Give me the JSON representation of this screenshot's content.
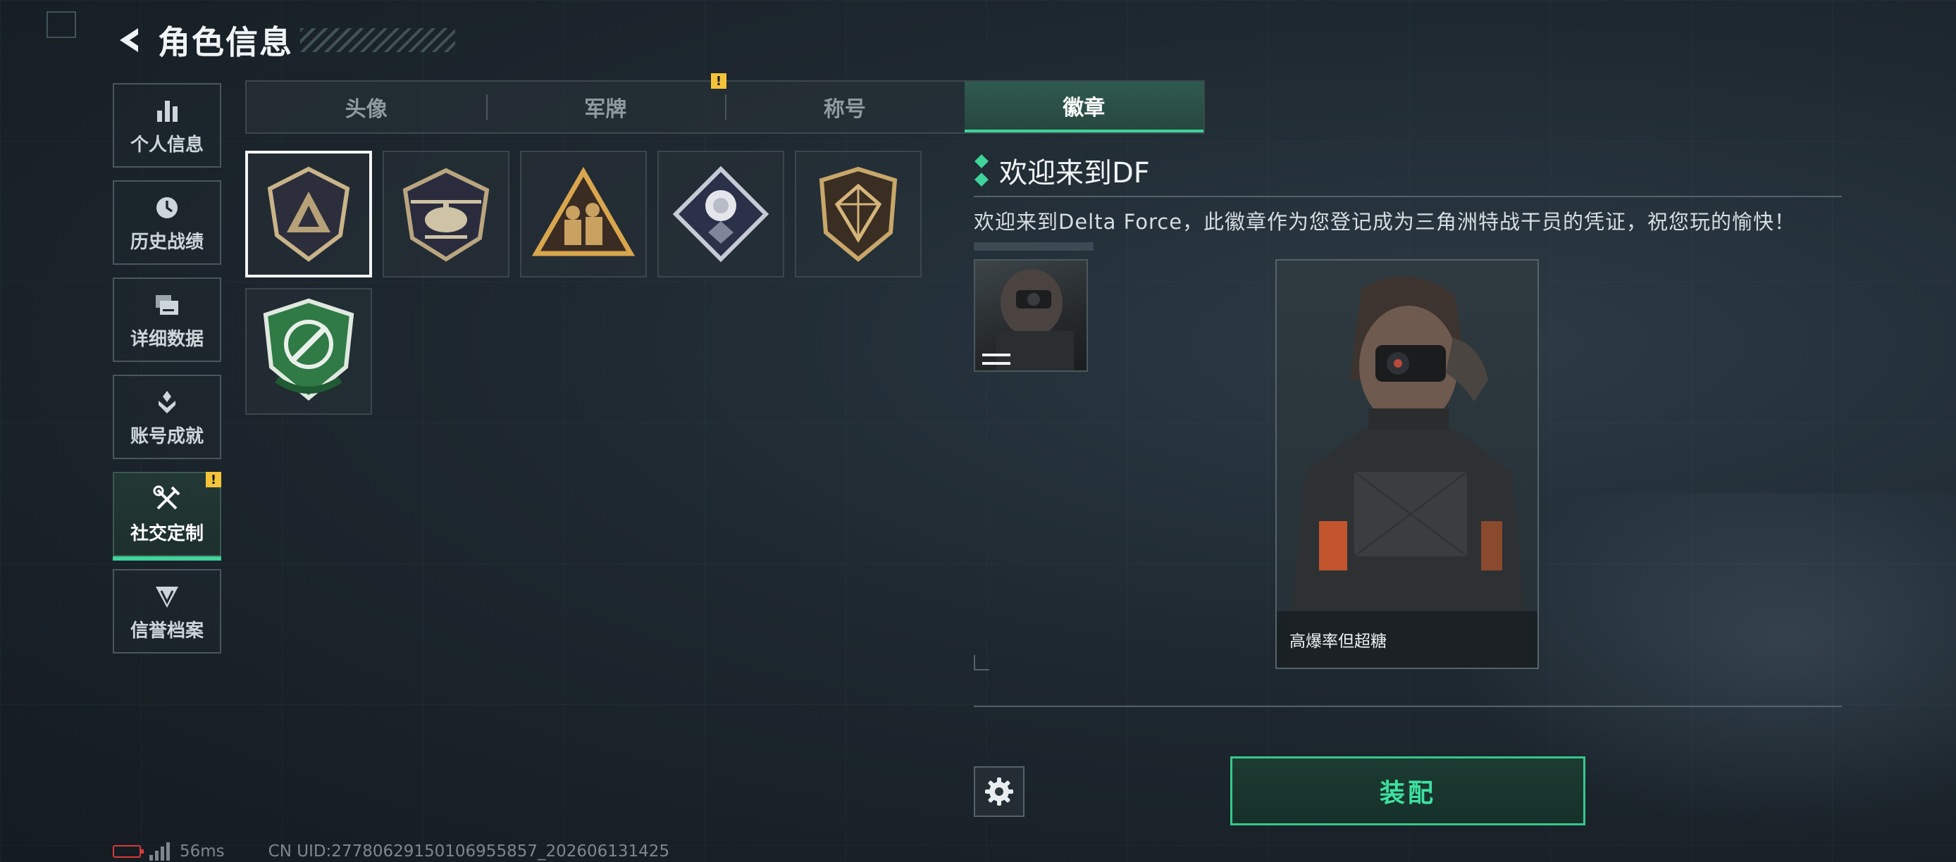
{
  "header": {
    "title": "角色信息"
  },
  "sidebar": {
    "items": [
      {
        "label": "个人信息",
        "icon": "bar-chart-icon",
        "active": false
      },
      {
        "label": "历史战绩",
        "icon": "history-icon",
        "active": false
      },
      {
        "label": "详细数据",
        "icon": "folder-icon",
        "active": false
      },
      {
        "label": "账号成就",
        "icon": "achievement-icon",
        "active": false
      },
      {
        "label": "社交定制",
        "icon": "tools-icon",
        "active": true,
        "alert": "!"
      },
      {
        "label": "信誉档案",
        "icon": "reputation-icon",
        "active": false
      }
    ]
  },
  "tabs": [
    {
      "label": "头像",
      "active": false
    },
    {
      "label": "军牌",
      "active": false,
      "alert": "!"
    },
    {
      "label": "称号",
      "active": false
    },
    {
      "label": "徽章",
      "active": true
    }
  ],
  "badges": [
    {
      "name": "delta-shield-badge",
      "selected": true
    },
    {
      "name": "helicopter-badge",
      "selected": false
    },
    {
      "name": "soldiers-triangle-badge",
      "selected": false
    },
    {
      "name": "rose-diamond-badge",
      "selected": false
    },
    {
      "name": "diamond-shield-badge",
      "selected": false
    },
    {
      "name": "green-target-badge",
      "selected": false
    }
  ],
  "detail": {
    "title": "欢迎来到DF",
    "description": "欢迎来到Delta Force，此徽章作为您登记成为三角洲特战干员的凭证，祝您玩的愉快！",
    "preview_caption": "高爆率但超糖"
  },
  "actions": {
    "equip_label": "装配"
  },
  "status": {
    "ping": "56ms",
    "uid": "CN UID:27780629150106955857_202606131425"
  },
  "colors": {
    "accent": "#3ed49a",
    "alert": "#f3c43b",
    "battery_low": "#d83a3a"
  }
}
